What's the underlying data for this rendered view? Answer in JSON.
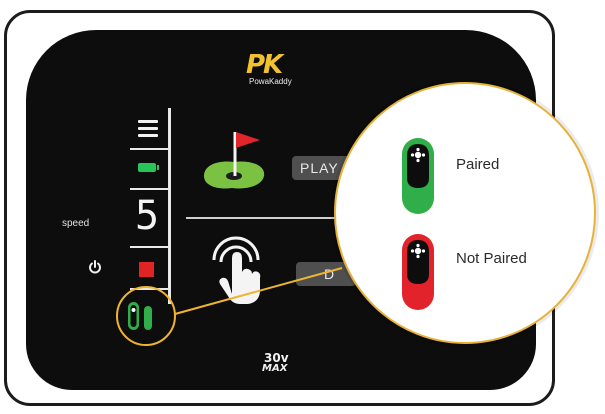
{
  "brand": {
    "mark": "PK",
    "name": "PowaKaddy"
  },
  "controls": {
    "speed_label": "speed",
    "speed_value": "5",
    "play_label": "PLAY",
    "secondary_label": "D"
  },
  "model": {
    "top": "30v",
    "bottom": "MAX"
  },
  "legend": {
    "paired_label": "Paired",
    "not_paired_label": "Not Paired"
  },
  "icons": [
    "menu-icon",
    "battery-icon",
    "power-icon",
    "stop-icon",
    "golf-green-flag-icon",
    "hand-touch-icon",
    "pairing-status-icon"
  ],
  "colors": {
    "screen": "#0d0d0d",
    "paired_green": "#2fae49",
    "not_paired_red": "#e3232b",
    "highlight": "#efb430",
    "battery": "#27c45a",
    "stop": "#e02424",
    "brand": "#f2c12e"
  }
}
